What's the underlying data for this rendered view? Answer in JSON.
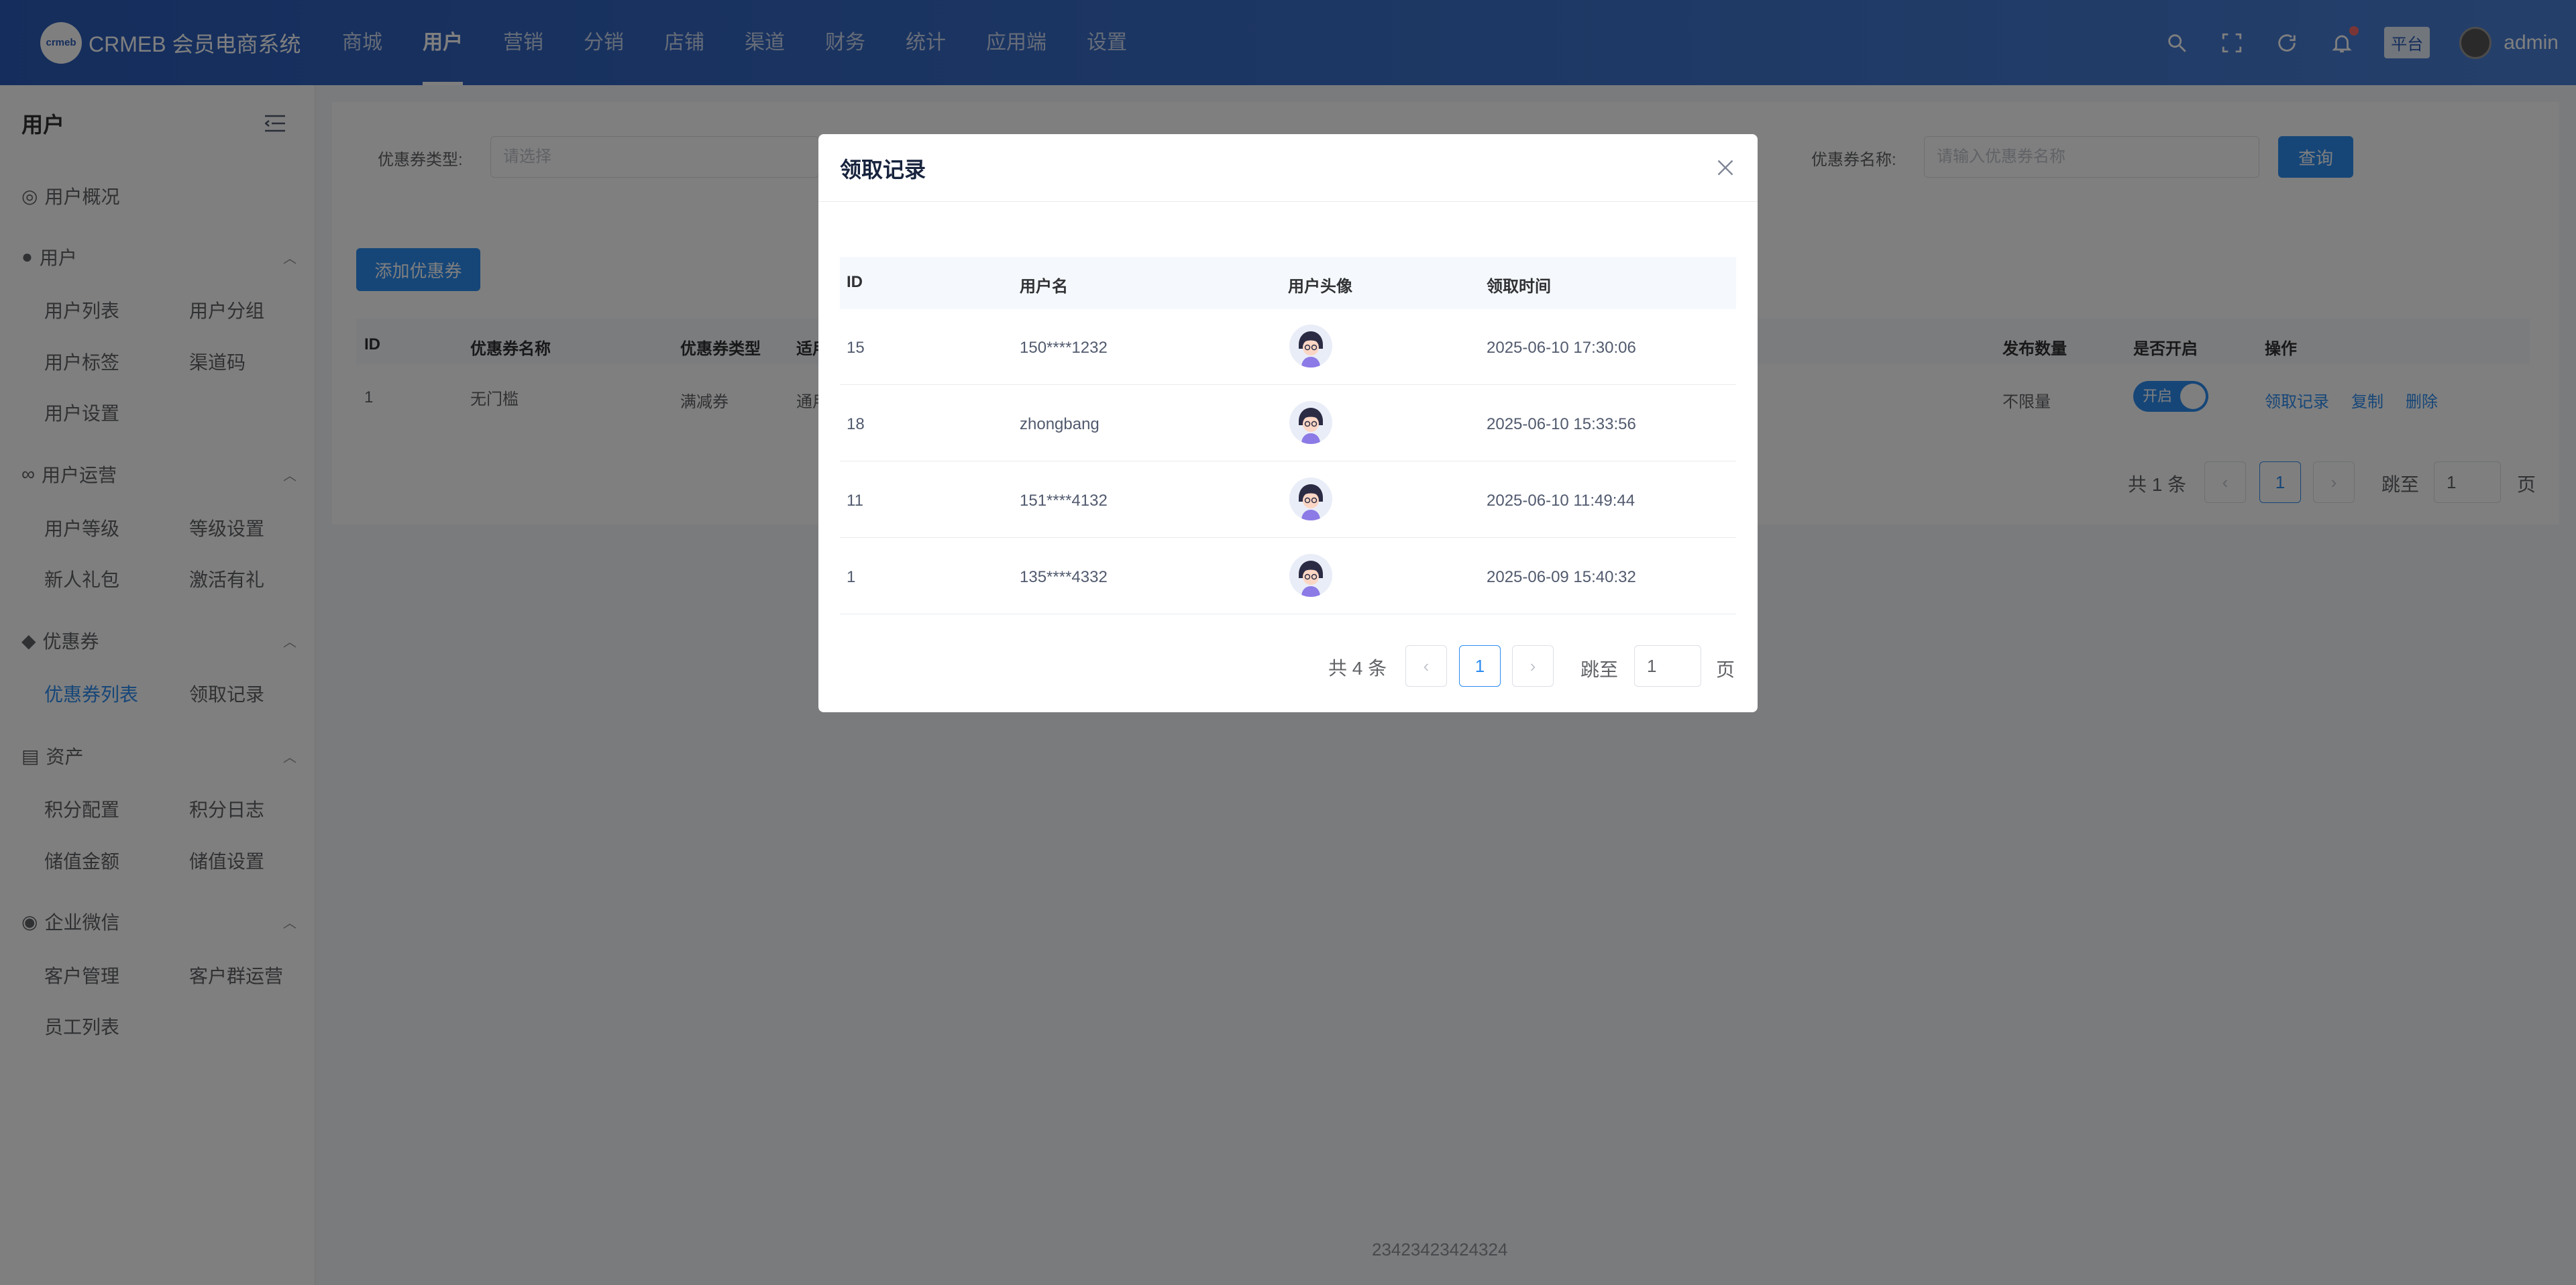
{
  "header": {
    "logo_badge": "crmeb",
    "app_title": "CRMEB 会员电商系统",
    "nav": [
      "商城",
      "用户",
      "营销",
      "分销",
      "店铺",
      "渠道",
      "财务",
      "统计",
      "应用端",
      "设置"
    ],
    "platform_tag": "平台",
    "user": "admin"
  },
  "sidebar": {
    "title": "用户",
    "groups": [
      {
        "label": "用户概况"
      },
      {
        "label": "用户",
        "links": [
          "用户列表",
          "用户分组",
          "用户标签",
          "渠道码",
          "用户设置"
        ]
      },
      {
        "label": "用户运营",
        "links": [
          "用户等级",
          "等级设置",
          "新人礼包",
          "激活有礼"
        ]
      },
      {
        "label": "优惠券",
        "links": [
          "优惠券列表",
          "领取记录"
        ]
      },
      {
        "label": "资产",
        "links": [
          "积分配置",
          "积分日志",
          "储值金额",
          "储值设置"
        ]
      },
      {
        "label": "企业微信",
        "links": [
          "客户管理",
          "客户群运营",
          "员工列表"
        ]
      }
    ]
  },
  "filters": {
    "type_label": "优惠券类型:",
    "type_placeholder": "请选择",
    "name_label": "优惠券名称:",
    "name_placeholder": "请输入优惠券名称",
    "query": "查询"
  },
  "coupon_table": {
    "add_button": "添加优惠券",
    "headers": [
      "ID",
      "优惠券名称",
      "优惠券类型",
      "适用",
      "发布数量",
      "是否开启",
      "操作"
    ],
    "row": {
      "id": "1",
      "name": "无门槛",
      "type": "满减券",
      "scope": "通用",
      "quantity": "不限量",
      "enabled": "开启",
      "actions": [
        "领取记录",
        "复制",
        "删除"
      ]
    },
    "pagination": {
      "total": "共 1 条",
      "page": "1",
      "jump": "跳至",
      "jump_value": "1",
      "unit": "页"
    }
  },
  "footer": "23423423424324",
  "modal": {
    "title": "领取记录",
    "headers": [
      "ID",
      "用户名",
      "用户头像",
      "领取时间"
    ],
    "rows": [
      {
        "id": "15",
        "name": "150****1232",
        "time": "2025-06-10 17:30:06"
      },
      {
        "id": "18",
        "name": "zhongbang",
        "time": "2025-06-10 15:33:56"
      },
      {
        "id": "11",
        "name": "151****4132",
        "time": "2025-06-10 11:49:44"
      },
      {
        "id": "1",
        "name": "135****4332",
        "time": "2025-06-09 15:40:32"
      }
    ],
    "pagination": {
      "total": "共 4 条",
      "page": "1",
      "jump": "跳至",
      "jump_value": "1",
      "unit": "页"
    }
  },
  "colors": {
    "primary": "#2d8cf0",
    "header": "#2a5bb8"
  }
}
